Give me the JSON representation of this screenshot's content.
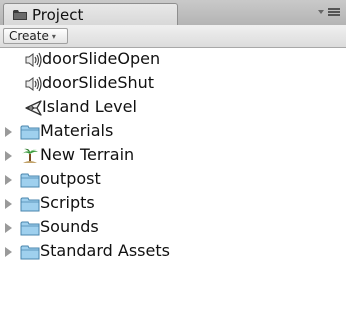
{
  "window": {
    "tab_title": "Project",
    "tab_icon": "folder-icon",
    "menu_icon": "panel-menu-icon"
  },
  "toolbar": {
    "create_label": "Create",
    "create_arrow": "▾"
  },
  "items": [
    {
      "label": "doorSlideOpen",
      "icon": "audio-clip-icon",
      "type": "asset"
    },
    {
      "label": "doorSlideShut",
      "icon": "audio-clip-icon",
      "type": "asset"
    },
    {
      "label": "Island Level",
      "icon": "unity-scene-icon",
      "type": "asset"
    },
    {
      "label": "Materials",
      "icon": "folder-icon",
      "type": "folder"
    },
    {
      "label": "New Terrain",
      "icon": "terrain-icon",
      "type": "folder"
    },
    {
      "label": "outpost",
      "icon": "folder-icon",
      "type": "folder"
    },
    {
      "label": "Scripts",
      "icon": "folder-icon",
      "type": "folder"
    },
    {
      "label": "Sounds",
      "icon": "folder-icon",
      "type": "folder"
    },
    {
      "label": "Standard Assets",
      "icon": "folder-icon",
      "type": "folder"
    }
  ],
  "colors": {
    "folder_fill": "#9fd0ee",
    "folder_stroke": "#4a86ad",
    "foldout": "#9a9a9a"
  }
}
